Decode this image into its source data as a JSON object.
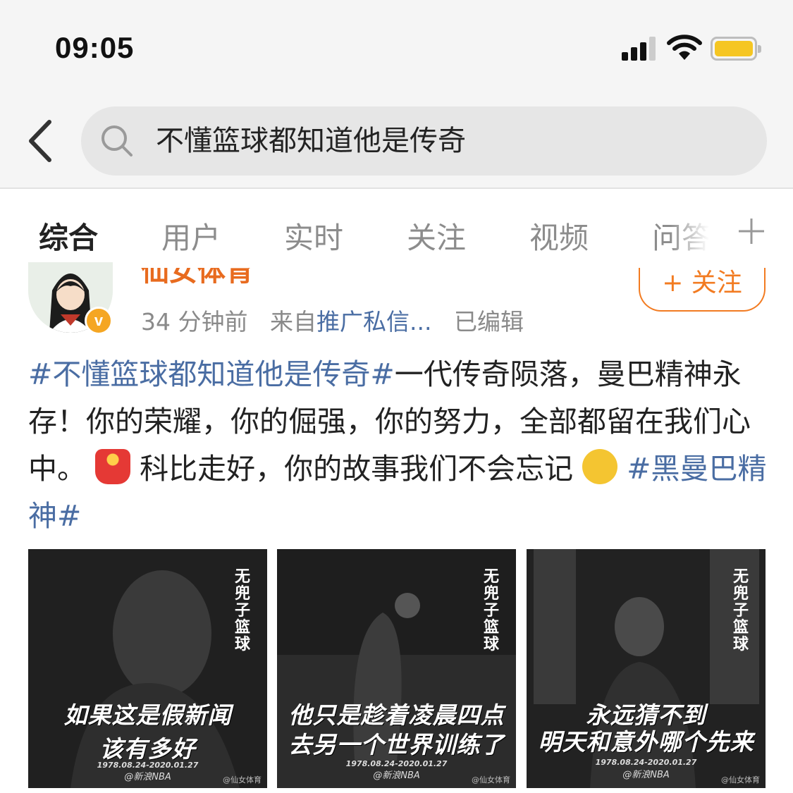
{
  "status_bar": {
    "time": "09:05",
    "battery_color": "#f5c623"
  },
  "search": {
    "query": "不懂篮球都知道他是传奇",
    "icon": "search-icon"
  },
  "tabs": [
    {
      "label": "综合",
      "active": true
    },
    {
      "label": "用户"
    },
    {
      "label": "实时"
    },
    {
      "label": "关注"
    },
    {
      "label": "视频"
    },
    {
      "label": "问答"
    }
  ],
  "post": {
    "username": "仙女体育",
    "follow_label": "+ 关注",
    "time_ago": "34 分钟前",
    "source_prefix": "来自",
    "source": "推广私信...",
    "edited": "已编辑",
    "verified_badge": "v",
    "text": {
      "hashtag1": "#不懂篮球都知道他是传奇#",
      "body1": "一代传奇陨落，曼巴精神永存！你的荣耀，你的倔强，你的努力，全部都留在我们心中。",
      "body2": " 科比走好，你的故事我们不会忘记 ",
      "hashtag2": "#黑曼巴精神#"
    },
    "images": [
      {
        "caption_line1": "如果这是假新闻",
        "caption_line2": "该有多好",
        "dates": "1978.08.24-2020.01.27",
        "credit": "@新浪NBA",
        "logo": "无兜子篮球",
        "watermark": "@仙女体育"
      },
      {
        "caption_line1": "他只是趁着凌晨四点",
        "caption_line2": "去另一个世界训练了",
        "dates": "1978.08.24-2020.01.27",
        "credit": "@新浪NBA",
        "logo": "无兜子篮球",
        "watermark": "@仙女体育"
      },
      {
        "caption_line1": "永远猜不到",
        "caption_line2": "明天和意外哪个先来",
        "dates": "1978.08.24-2020.01.27",
        "credit": "@新浪NBA",
        "logo": "无兜子篮球",
        "watermark": "@仙女体育"
      }
    ]
  },
  "colors": {
    "accent": "#f27b21",
    "link": "#4a6da3"
  }
}
